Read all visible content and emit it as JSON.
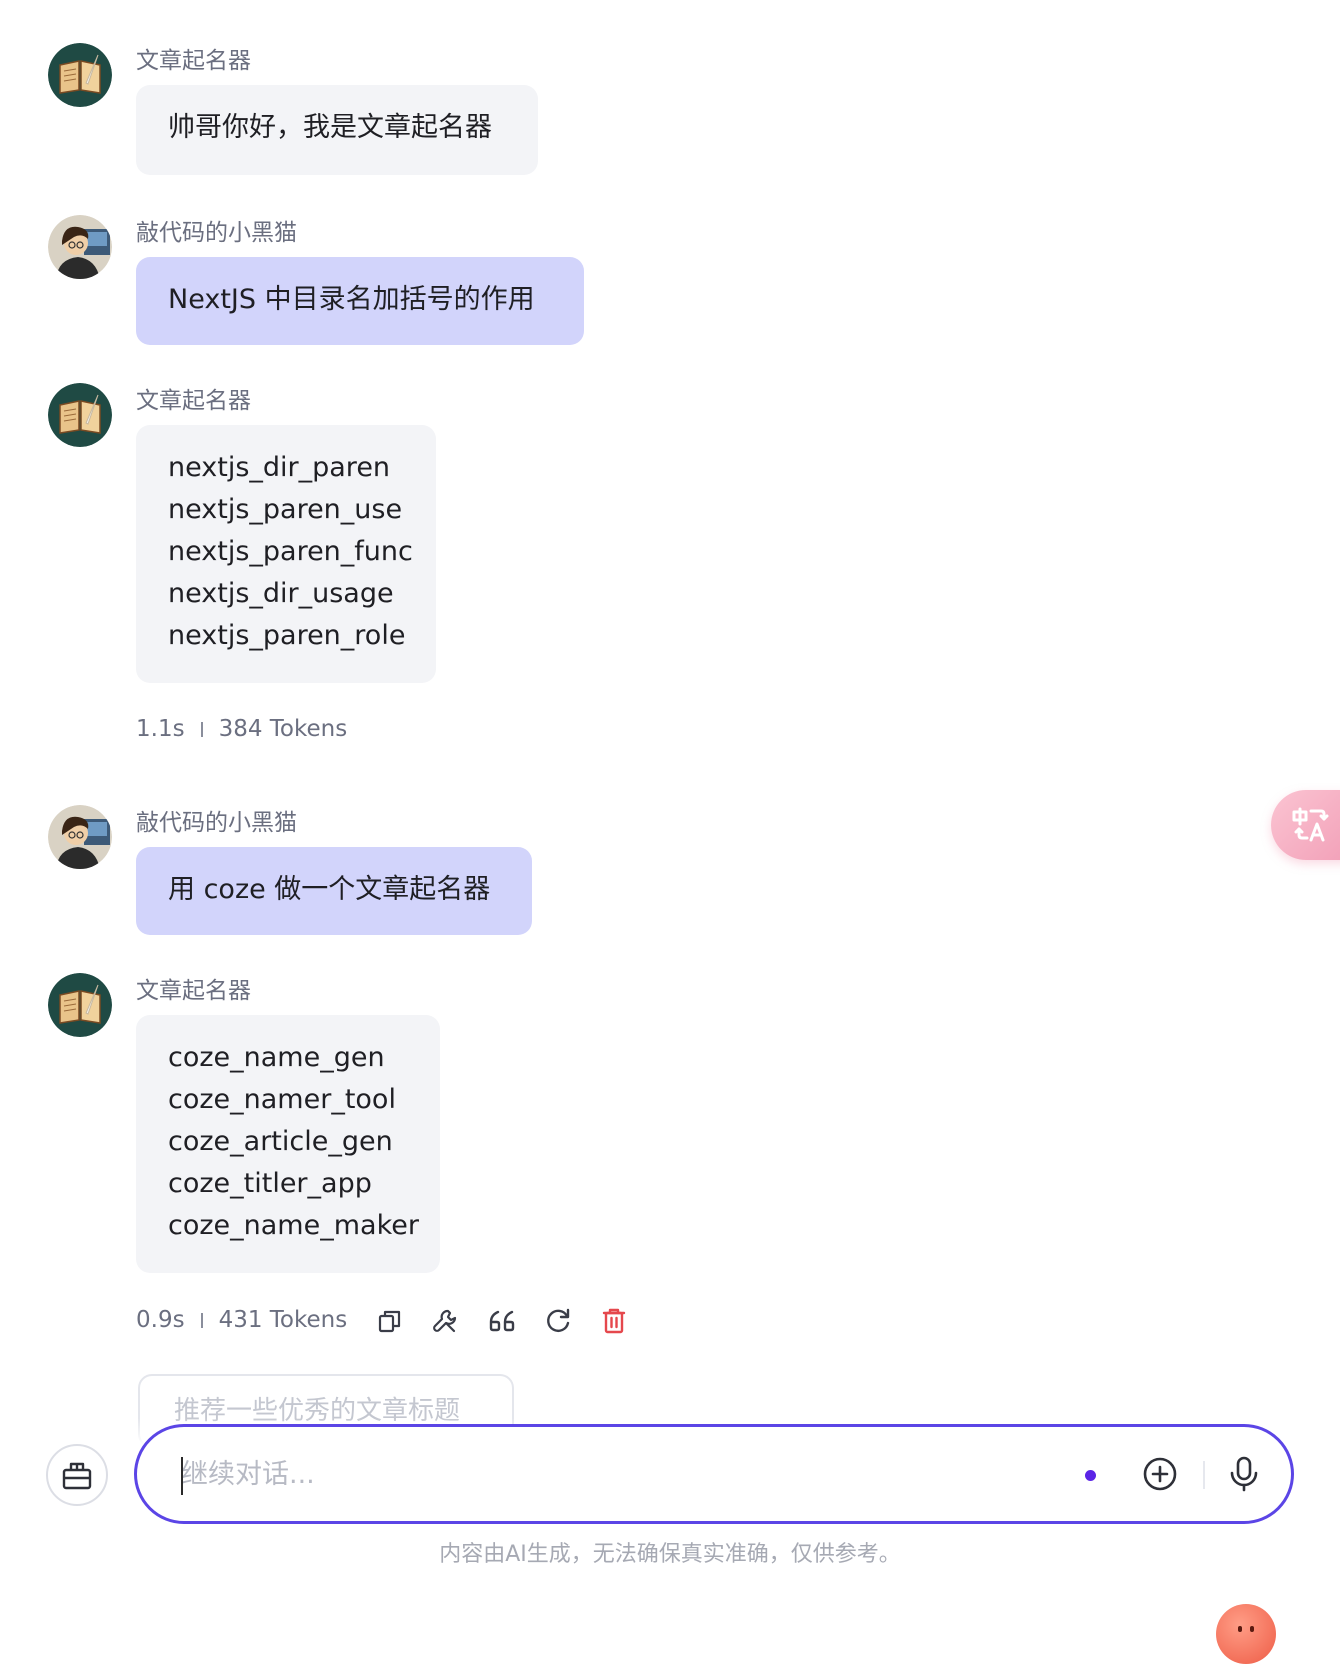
{
  "colors": {
    "accent": "#5b45e6",
    "bot_bubble": "#f3f4f7",
    "user_bubble": "#d2d4fb",
    "delete": "#e5484d"
  },
  "messages": [
    {
      "role": "bot",
      "sender": "文章起名器",
      "lines": [
        "帅哥你好，我是文章起名器"
      ]
    },
    {
      "role": "user",
      "sender": "敲代码的小黑猫",
      "lines": [
        "NextJS 中目录名加括号的作用"
      ]
    },
    {
      "role": "bot",
      "sender": "文章起名器",
      "lines": [
        "nextjs_dir_paren",
        "nextjs_paren_use",
        "nextjs_paren_func",
        "nextjs_dir_usage",
        "nextjs_paren_role"
      ],
      "time": "1.1s",
      "tokens": "384 Tokens"
    },
    {
      "role": "user",
      "sender": "敲代码的小黑猫",
      "lines": [
        "用 coze 做一个文章起名器"
      ]
    },
    {
      "role": "bot",
      "sender": "文章起名器",
      "lines": [
        "coze_name_gen",
        "coze_namer_tool",
        "coze_article_gen",
        "coze_titler_app",
        "coze_name_maker"
      ],
      "time": "0.9s",
      "tokens": "431 Tokens"
    }
  ],
  "actions": [
    {
      "icon": "copy-icon"
    },
    {
      "icon": "wrench-icon"
    },
    {
      "icon": "quote-icon"
    },
    {
      "icon": "refresh-icon"
    },
    {
      "icon": "trash-icon"
    }
  ],
  "suggestion": "推荐一些优秀的文章标题",
  "input": {
    "placeholder": "继续对话...",
    "value": ""
  },
  "disclaimer": "内容由AI生成，无法确保真实准确，仅供参考。",
  "icons": {
    "translate": "translate-icon",
    "toolbox": "toolbox-icon",
    "add": "plus-circle-icon",
    "voice": "microphone-icon",
    "assistant": "mascot-icon"
  }
}
